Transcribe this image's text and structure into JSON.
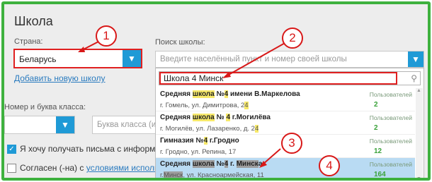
{
  "title": "Школа",
  "country": {
    "label": "Страна:",
    "value": "Беларусь",
    "arrow_icon": "chevron-down-icon"
  },
  "add_school_link": "Добавить новую школу",
  "school_search": {
    "label": "Поиск школы:",
    "placeholder": "Введите населённый пункт и номер своей школы",
    "query": "Школа 4 Минск"
  },
  "results": [
    {
      "name_parts": [
        [
          "Средняя ",
          ""
        ],
        [
          "школа",
          "y"
        ],
        [
          " №",
          ""
        ],
        [
          "4",
          "y"
        ],
        [
          " имени В.Маркелова",
          ""
        ]
      ],
      "addr_parts": [
        [
          "г. Гомель, ул. Димитрова, 2",
          ""
        ],
        [
          "4",
          "y"
        ]
      ],
      "users_label": "Пользователей",
      "count": "2",
      "selected": false
    },
    {
      "name_parts": [
        [
          "Средняя ",
          ""
        ],
        [
          "школа",
          "y"
        ],
        [
          " № ",
          ""
        ],
        [
          "4",
          "y"
        ],
        [
          " г.Могилёва",
          ""
        ]
      ],
      "addr_parts": [
        [
          "г. Могилёв, ул. Лазаренко, д. 2",
          ""
        ],
        [
          "4",
          "y"
        ]
      ],
      "users_label": "Пользователей",
      "count": "2",
      "selected": false
    },
    {
      "name_parts": [
        [
          "Гимназия №",
          ""
        ],
        [
          "4",
          "y"
        ],
        [
          " г.Гродно",
          ""
        ]
      ],
      "addr_parts": [
        [
          "г. Гродно, ул. Репина, 17",
          ""
        ]
      ],
      "users_label": "Пользователей",
      "count": "12",
      "selected": false
    },
    {
      "name_parts": [
        [
          "Средняя ",
          ""
        ],
        [
          "школа",
          "g"
        ],
        [
          " №",
          ""
        ],
        [
          "4",
          "g"
        ],
        [
          " г. ",
          ""
        ],
        [
          "Минск",
          "g"
        ],
        [
          "а",
          ""
        ]
      ],
      "addr_parts": [
        [
          "г.",
          ""
        ],
        [
          "Минск",
          "g"
        ],
        [
          ", ул. Красноармейская, 11",
          ""
        ]
      ],
      "users_label": "Пользователей",
      "count": "164",
      "selected": true
    }
  ],
  "class": {
    "label": "Номер и буква класса:",
    "letter_placeholder": "Буква класса (или"
  },
  "newsletter": {
    "text": "Я хочу получать письма с информацие",
    "checked": true
  },
  "terms": {
    "text_before": "Согласен (-на) с ",
    "link": "условиями использова",
    "checked": false
  },
  "callouts": [
    "1",
    "2",
    "3",
    "4"
  ],
  "colors": {
    "accent": "#1f9ad6",
    "annotation": "#d81818",
    "frame": "#3eb13e",
    "selected_row": "#b9dbf3"
  }
}
